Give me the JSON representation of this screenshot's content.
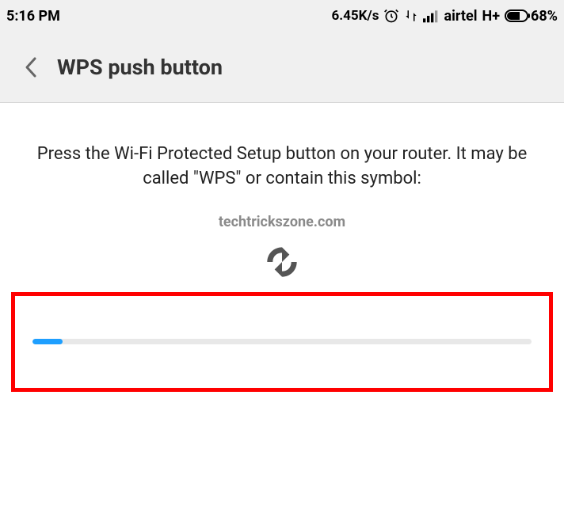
{
  "statusbar": {
    "time": "5:16 PM",
    "speed": "6.45K/s",
    "carrier": "airtel",
    "network_type": "H+",
    "battery_pct": "68%",
    "battery_fill_pct": 68
  },
  "header": {
    "title": "WPS push button"
  },
  "content": {
    "instruction": "Press the Wi-Fi Protected Setup button on your router. It may be called \"WPS\" or contain this symbol:",
    "watermark": "techtrickszone.com"
  },
  "progress": {
    "value_pct": 6
  }
}
